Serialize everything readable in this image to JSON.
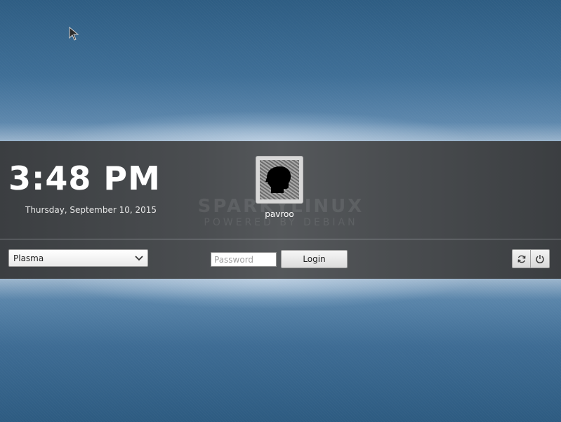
{
  "clock": {
    "time": "3:48 PM",
    "date": "Thursday, September 10, 2015"
  },
  "watermark": {
    "main": "SPARKYLINUX",
    "sub": "POWERED BY DEBIAN"
  },
  "user": {
    "name": "pavroo",
    "avatar_icon": "user-head-icon"
  },
  "session": {
    "selected": "Plasma",
    "icon": "chevron-down-icon"
  },
  "password": {
    "value": "",
    "placeholder": "Password"
  },
  "login": {
    "label": "Login"
  },
  "power": {
    "reboot_icon": "reboot-icon",
    "shutdown_icon": "power-icon"
  },
  "colors": {
    "wallpaper": "#3f6f97",
    "panel": "#4a4d50",
    "text": "#ffffff"
  }
}
